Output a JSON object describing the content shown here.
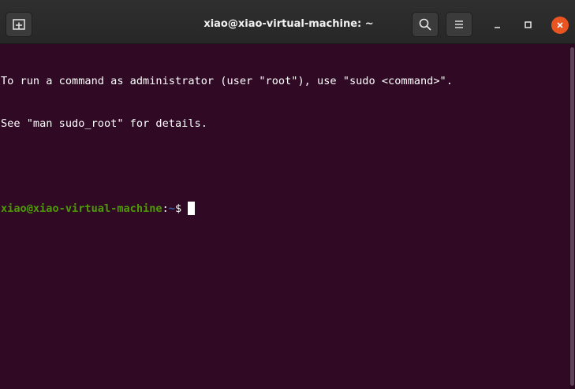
{
  "window": {
    "title": "xiao@xiao-virtual-machine: ~"
  },
  "toolbar": {
    "new_tab_icon": "new-tab-icon",
    "search_icon": "search-icon",
    "menu_icon": "hamburger-menu-icon",
    "minimize_icon": "minimize-icon",
    "maximize_icon": "maximize-icon",
    "close_icon": "close-icon"
  },
  "terminal": {
    "lines": [
      "To run a command as administrator (user \"root\"), use \"sudo <command>\".",
      "See \"man sudo_root\" for details.",
      ""
    ],
    "prompt": {
      "user_host": "xiao@xiao-virtual-machine",
      "separator": ":",
      "path": "~",
      "symbol": "$ "
    }
  },
  "colors": {
    "background": "#300a24",
    "titlebar": "#2b2b2b",
    "prompt_user": "#4e9a06",
    "prompt_path": "#3465a4",
    "close_button": "#e95420"
  }
}
